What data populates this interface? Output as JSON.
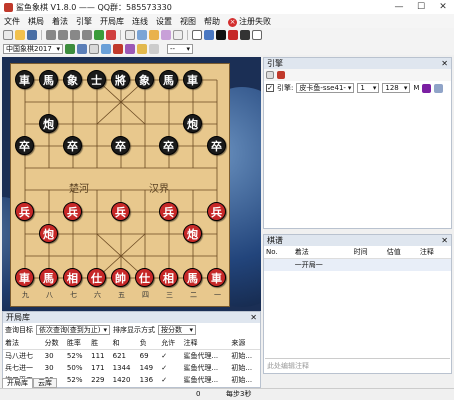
{
  "window": {
    "title": "鲨鱼象棋 V1.8.0 —— QQ群：585573330",
    "minimize": "—",
    "maximize": "☐",
    "close": "✕"
  },
  "menu": {
    "items": [
      "文件",
      "棋局",
      "着法",
      "引擎",
      "开局库",
      "连线",
      "设置",
      "视图",
      "帮助"
    ],
    "register": "注册失败"
  },
  "toolbar2": {
    "opening_select": "中国象棋2017",
    "zoom_select": "--"
  },
  "board": {
    "pieces": [
      {
        "ch": "車",
        "side": "black",
        "f": 0,
        "r": 0
      },
      {
        "ch": "馬",
        "side": "black",
        "f": 1,
        "r": 0
      },
      {
        "ch": "象",
        "side": "black",
        "f": 2,
        "r": 0
      },
      {
        "ch": "士",
        "side": "black",
        "f": 3,
        "r": 0
      },
      {
        "ch": "將",
        "side": "black",
        "f": 4,
        "r": 0
      },
      {
        "ch": "象",
        "side": "black",
        "f": 5,
        "r": 0
      },
      {
        "ch": "馬",
        "side": "black",
        "f": 6,
        "r": 0
      },
      {
        "ch": "車",
        "side": "black",
        "f": 7,
        "r": 0
      },
      {
        "ch": "炮",
        "side": "black",
        "f": 1,
        "r": 2
      },
      {
        "ch": "炮",
        "side": "black",
        "f": 7,
        "r": 2
      },
      {
        "ch": "卒",
        "side": "black",
        "f": 0,
        "r": 3
      },
      {
        "ch": "卒",
        "side": "black",
        "f": 2,
        "r": 3
      },
      {
        "ch": "卒",
        "side": "black",
        "f": 4,
        "r": 3
      },
      {
        "ch": "卒",
        "side": "black",
        "f": 6,
        "r": 3
      },
      {
        "ch": "卒",
        "side": "black",
        "f": 8,
        "r": 3
      },
      {
        "ch": "兵",
        "side": "red",
        "f": 0,
        "r": 6
      },
      {
        "ch": "兵",
        "side": "red",
        "f": 2,
        "r": 6
      },
      {
        "ch": "兵",
        "side": "red",
        "f": 4,
        "r": 6
      },
      {
        "ch": "兵",
        "side": "red",
        "f": 6,
        "r": 6
      },
      {
        "ch": "兵",
        "side": "red",
        "f": 8,
        "r": 6
      },
      {
        "ch": "炮",
        "side": "red",
        "f": 1,
        "r": 7
      },
      {
        "ch": "炮",
        "side": "red",
        "f": 7,
        "r": 7
      },
      {
        "ch": "車",
        "side": "red",
        "f": 0,
        "r": 9
      },
      {
        "ch": "馬",
        "side": "red",
        "f": 1,
        "r": 9
      },
      {
        "ch": "相",
        "side": "red",
        "f": 2,
        "r": 9
      },
      {
        "ch": "仕",
        "side": "red",
        "f": 3,
        "r": 9
      },
      {
        "ch": "帥",
        "side": "red",
        "f": 4,
        "r": 9
      },
      {
        "ch": "仕",
        "side": "red",
        "f": 5,
        "r": 9
      },
      {
        "ch": "相",
        "side": "red",
        "f": 6,
        "r": 9
      },
      {
        "ch": "馬",
        "side": "red",
        "f": 7,
        "r": 9
      },
      {
        "ch": "車",
        "side": "red",
        "f": 8,
        "r": 9
      }
    ],
    "river_left": "楚河",
    "river_right": "汉界",
    "file_numbers": [
      "九",
      "八",
      "七",
      "六",
      "五",
      "四",
      "三",
      "二",
      "一"
    ]
  },
  "engine": {
    "title": "引擎",
    "enable_label": "引擎:",
    "engine_select": "皮卡鱼-sse41-",
    "threads_select": "1",
    "hash_select": "128",
    "hash_unit": "M"
  },
  "qipu": {
    "title": "棋谱",
    "headers": [
      "No.",
      "着法",
      "时间",
      "估值",
      "注释"
    ],
    "rows": [
      [
        "",
        "一开局一",
        "",
        "",
        ""
      ]
    ],
    "comment_placeholder": "此处编辑注释"
  },
  "opening": {
    "title": "开局库",
    "query_label": "查询目标",
    "query_select": "依次查询(查到为止)",
    "sort_label": "排序显示方式",
    "sort_select": "按分数",
    "headers": [
      "着法",
      "分数",
      "胜率",
      "胜",
      "和",
      "负",
      "允许",
      "注释",
      "来源"
    ],
    "rows": [
      [
        "马八进七",
        "30",
        "52%",
        "111",
        "621",
        "69",
        "✓",
        "鲨鱼代理...",
        "初始..."
      ],
      [
        "兵七进一",
        "30",
        "50%",
        "171",
        "1344",
        "149",
        "✓",
        "鲨鱼代理...",
        "初始..."
      ],
      [
        "炮二平五",
        "30",
        "52%",
        "229",
        "1420",
        "136",
        "✓",
        "鲨鱼代理...",
        "初始..."
      ]
    ]
  },
  "tabs": [
    "开局库",
    "云库"
  ],
  "status": {
    "value": "0",
    "step": "每步3秒"
  }
}
